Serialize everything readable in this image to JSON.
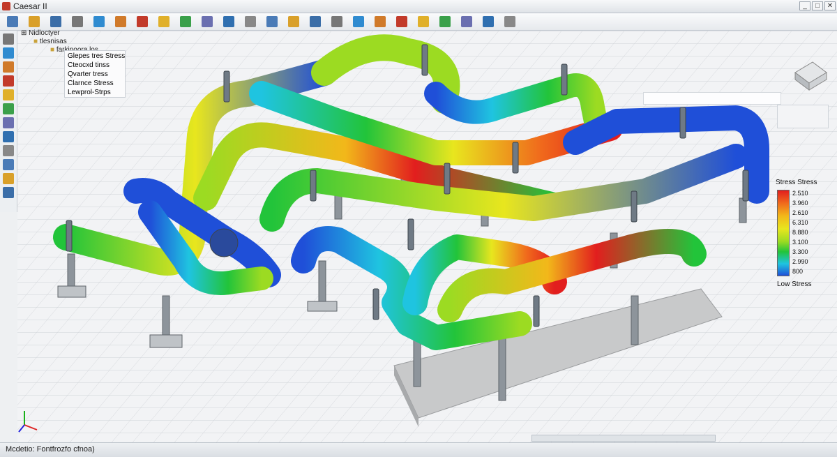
{
  "window": {
    "title": "Caesar II",
    "min_label": "_",
    "max_label": "□",
    "close_label": "✕"
  },
  "toolbar": {
    "icons": [
      "new-file-icon",
      "open-folder-icon",
      "save-icon",
      "print-icon",
      "zoom-icon",
      "pan-icon",
      "rotate-icon",
      "paste-icon",
      "layers-icon",
      "grid-icon",
      "pipe-icon",
      "select-icon",
      "move-icon",
      "copy-icon",
      "valve-icon",
      "flange-icon",
      "chart-icon",
      "support-icon",
      "report-icon",
      "analysis-icon",
      "bookmark-icon",
      "run-icon",
      "graph-icon",
      "help-icon"
    ]
  },
  "left_tools": {
    "icons": [
      "pointer-icon",
      "node-icon",
      "element-icon",
      "bend-icon",
      "tee-icon",
      "reducer-icon",
      "valve-tool-icon",
      "restraint-icon",
      "hanger-icon",
      "nozzle-icon",
      "displacement-icon",
      "force-icon"
    ]
  },
  "tree": {
    "root": "Nidloctyer",
    "child1": "tlesnisas",
    "child2": "farkinoora los",
    "items": [
      "Glepes tres Stress",
      "Cteocxd tinss",
      "Qvarter tress",
      "Clarnce Stress",
      "Lewprol-Strps"
    ]
  },
  "legend": {
    "title": "Stress Stress",
    "values": [
      "2.510",
      "3.960",
      "2.610",
      "6.310",
      "8.880",
      "3.100",
      "3.300",
      "2.990",
      "800"
    ],
    "low_label": "Low Stress",
    "colors": [
      "#e21e1e",
      "#f06a1c",
      "#f2b81a",
      "#e8e61e",
      "#9cdb22",
      "#22c43a",
      "#1fc4e0",
      "#1f4fd8"
    ]
  },
  "status": {
    "text": "Mcdetio: Fontfrozfo cfnoa)"
  },
  "axes": {
    "x_label": "x",
    "y_label": "y",
    "z_label": "z"
  }
}
